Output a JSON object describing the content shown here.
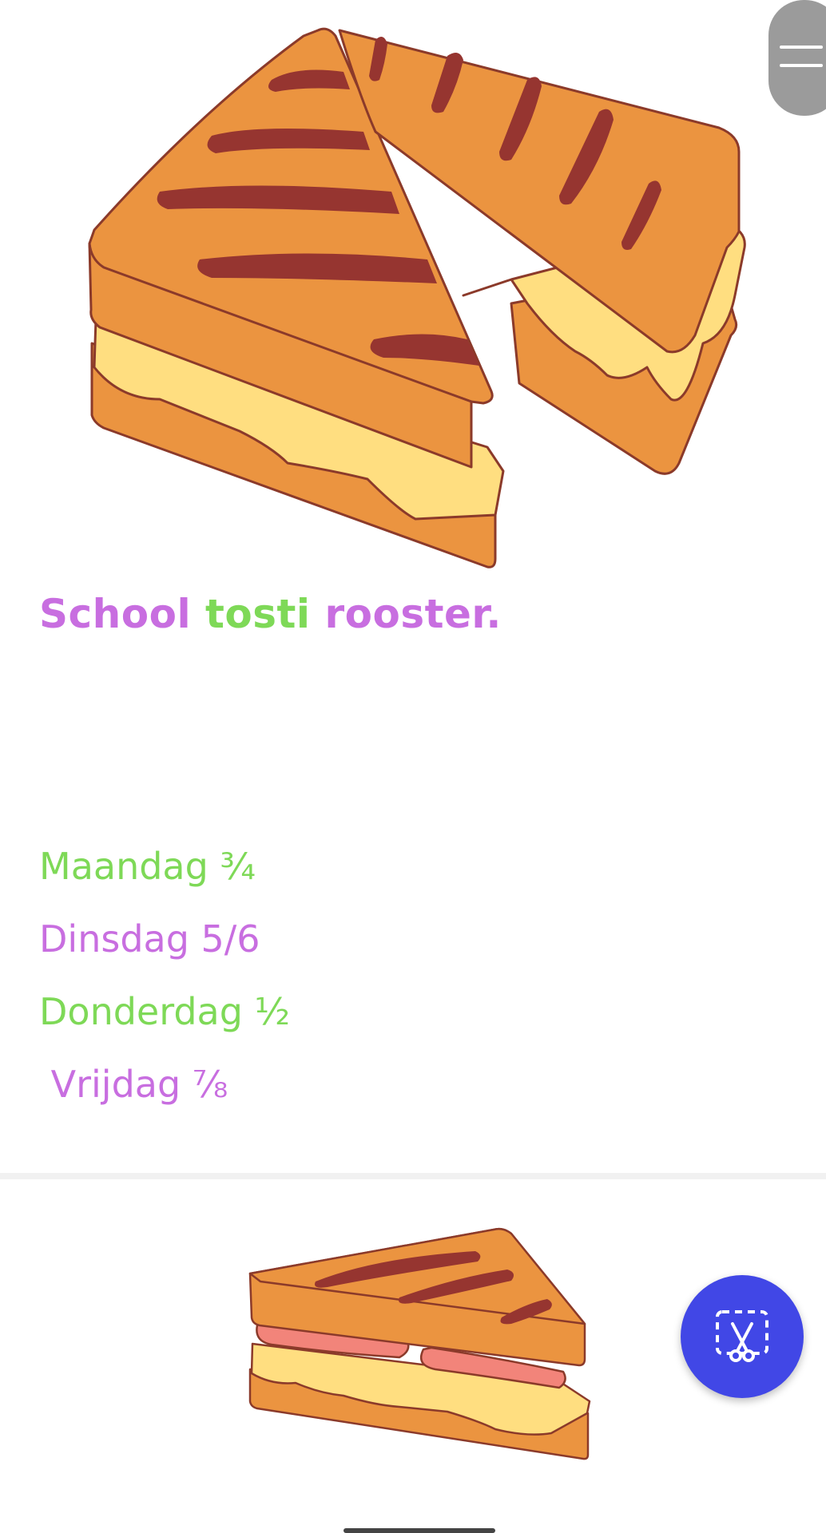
{
  "header": {
    "menu_icon": "hamburger-menu-icon"
  },
  "hero": {
    "illustration": "grilled-cheese-sandwich-illustration"
  },
  "title": {
    "word1": "School ",
    "word2": "tosti",
    "word3": " rooster."
  },
  "schedule": {
    "items": [
      {
        "text": "Maandag ¾",
        "color": "#7ed957"
      },
      {
        "text": "Dinsdag 5/6",
        "color": "#c86ee0"
      },
      {
        "text": "Donderdag ½",
        "color": "#7ed957"
      },
      {
        "text": " Vrijdag ⅞",
        "color": "#c86ee0"
      }
    ]
  },
  "bottom": {
    "illustration": "ham-cheese-toastie-illustration"
  },
  "fab": {
    "icon": "screenshot-scissors-icon"
  },
  "colors": {
    "purple": "#c86ee0",
    "green": "#7ed957",
    "fab": "#4147e6",
    "bread": "#eb9440",
    "grill": "#963530",
    "cheese": "#ffde80",
    "outline": "#8b3a2a",
    "ham": "#f2847a"
  }
}
